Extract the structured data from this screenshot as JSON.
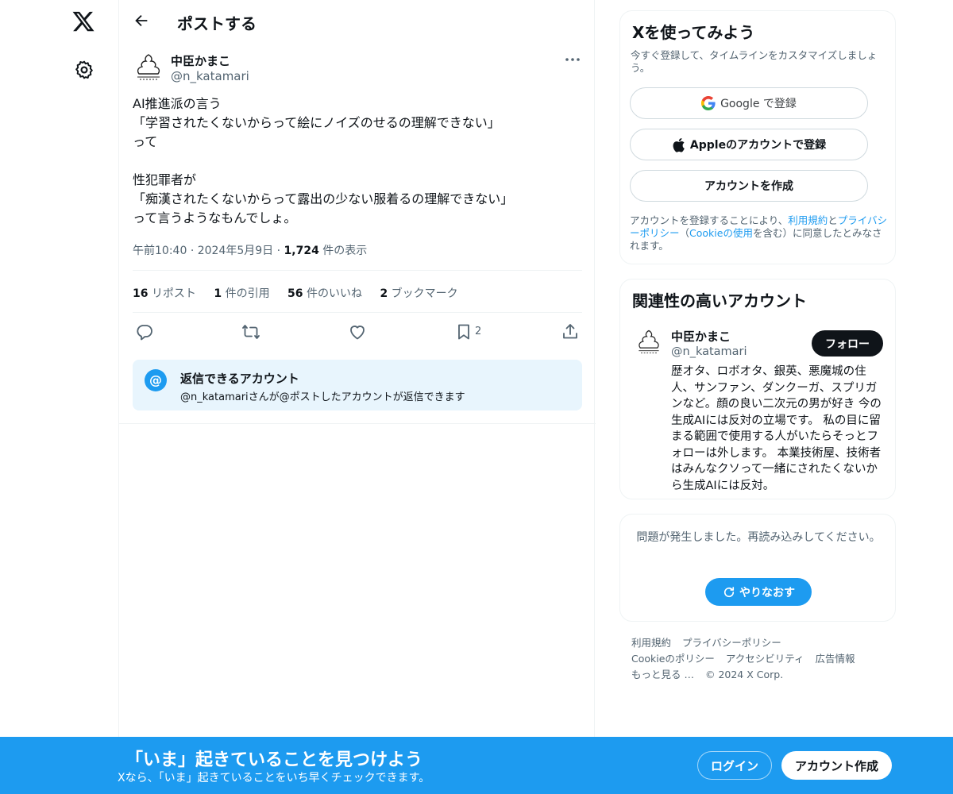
{
  "header": {
    "title": "ポストする"
  },
  "post": {
    "author_name": "中臣かまこ",
    "author_handle": "@n_katamari",
    "text": "AI推進派の言う\n「学習されたくないからって絵にノイズのせるの理解できない」\nって\n\n性犯罪者が\n「痴漢されたくないからって露出の少ない服着るの理解できない」\nって言うようなもんでしょ。",
    "time": "午前10:40",
    "date": "2024年5月9日",
    "views_count": "1,724",
    "views_label": "件の表示",
    "stats": [
      {
        "count": "16",
        "label": "リポスト"
      },
      {
        "count": "1",
        "label": "件の引用"
      },
      {
        "count": "56",
        "label": "件のいいね"
      },
      {
        "count": "2",
        "label": "ブックマーク"
      }
    ],
    "bookmark_count": "2"
  },
  "reply_restriction": {
    "title": "返信できるアカウント",
    "description": "@n_katamariさんが@ポストしたアカウントが返信できます"
  },
  "signup_card": {
    "title": "Xを使ってみよう",
    "subtitle": "今すぐ登録して、タイムラインをカスタマイズしましょう。",
    "google_label": "Google で登録",
    "apple_label": "Appleのアカウントで登録",
    "create_label": "アカウントを作成",
    "legal_prefix": "アカウントを登録することにより、",
    "legal_terms": "利用規約",
    "legal_and": "と",
    "legal_privacy": "プライバシーポリシー",
    "legal_mid": "（",
    "legal_cookie": "Cookieの使用",
    "legal_suffix": "を含む）に同意したとみなされます。"
  },
  "related_card": {
    "title": "関連性の高いアカウント",
    "name": "中臣かまこ",
    "handle": "@n_katamari",
    "follow_label": "フォロー",
    "bio": "歴オタ、ロボオタ、銀英、悪魔城の住人、サンファン、ダンクーガ、スプリガンなど。顔の良い二次元の男が好き 今の生成AIには反対の立場です。 私の目に留まる範囲で使用する人がいたらそっとフォローは外します。 本業技術屋、技術者はみんなクソって一緒にされたくないから生成AIには反対。"
  },
  "error_card": {
    "message": "問題が発生しました。再読み込みしてください。",
    "retry_label": "やりなおす"
  },
  "footer": {
    "links": [
      "利用規約",
      "プライバシーポリシー",
      "Cookieのポリシー",
      "アクセシビリティ",
      "広告情報",
      "もっと見る …",
      "© 2024 X Corp."
    ]
  },
  "banner": {
    "title": "「いま」起きていることを見つけよう",
    "subtitle": "Xなら、「いま」起きていることをいち早くチェックできます。",
    "login_label": "ログイン",
    "signup_label": "アカウント作成"
  },
  "colors": {
    "accent": "#1d9bf0",
    "text": "#0f1419",
    "secondary": "#536471",
    "border": "#eff3f4",
    "reply_bg": "#e8f5fd"
  },
  "icons": [
    "x-logo-icon",
    "gear-icon",
    "back-arrow-icon",
    "more-icon",
    "reply-icon",
    "repost-icon",
    "like-icon",
    "bookmark-icon",
    "share-icon",
    "at-icon",
    "google-icon",
    "apple-icon",
    "refresh-icon"
  ]
}
